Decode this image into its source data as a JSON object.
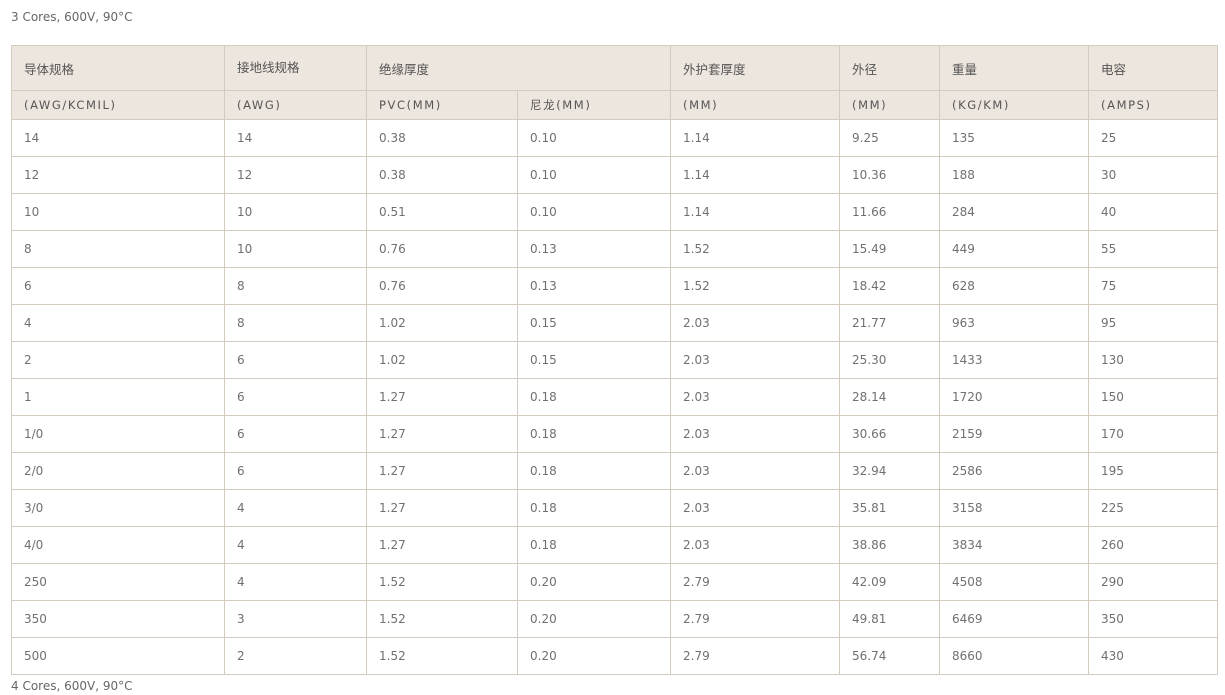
{
  "captions": {
    "top": "3 Cores, 600V, 90°C",
    "bottom": "4 Cores, 600V, 90°C"
  },
  "table": {
    "header_row1": {
      "conductor": "导体规格",
      "ground": "接地线规格",
      "insulation": "绝缘厚度",
      "jacket": "外护套厚度",
      "od": "外径",
      "weight": "重量",
      "capacity": "电容"
    },
    "header_row2": {
      "conductor": "(AWG/KCMIL)",
      "ground": "(AWG)",
      "pvc": "PVC(MM)",
      "nylon": "尼龙(MM)",
      "jacket": "(MM)",
      "od": "(MM)",
      "weight": "(KG/KM)",
      "capacity": "(AMPS)"
    },
    "rows": [
      [
        "14",
        "14",
        "0.38",
        "0.10",
        "1.14",
        "9.25",
        "135",
        "25"
      ],
      [
        "12",
        "12",
        "0.38",
        "0.10",
        "1.14",
        "10.36",
        "188",
        "30"
      ],
      [
        "10",
        "10",
        "0.51",
        "0.10",
        "1.14",
        "11.66",
        "284",
        "40"
      ],
      [
        "8",
        "10",
        "0.76",
        "0.13",
        "1.52",
        "15.49",
        "449",
        "55"
      ],
      [
        "6",
        "8",
        "0.76",
        "0.13",
        "1.52",
        "18.42",
        "628",
        "75"
      ],
      [
        "4",
        "8",
        "1.02",
        "0.15",
        "2.03",
        "21.77",
        "963",
        "95"
      ],
      [
        "2",
        "6",
        "1.02",
        "0.15",
        "2.03",
        "25.30",
        "1433",
        "130"
      ],
      [
        "1",
        "6",
        "1.27",
        "0.18",
        "2.03",
        "28.14",
        "1720",
        "150"
      ],
      [
        "1/0",
        "6",
        "1.27",
        "0.18",
        "2.03",
        "30.66",
        "2159",
        "170"
      ],
      [
        "2/0",
        "6",
        "1.27",
        "0.18",
        "2.03",
        "32.94",
        "2586",
        "195"
      ],
      [
        "3/0",
        "4",
        "1.27",
        "0.18",
        "2.03",
        "35.81",
        "3158",
        "225"
      ],
      [
        "4/0",
        "4",
        "1.27",
        "0.18",
        "2.03",
        "38.86",
        "3834",
        "260"
      ],
      [
        "250",
        "4",
        "1.52",
        "0.20",
        "2.79",
        "42.09",
        "4508",
        "290"
      ],
      [
        "350",
        "3",
        "1.52",
        "0.20",
        "2.79",
        "49.81",
        "6469",
        "350"
      ],
      [
        "500",
        "2",
        "1.52",
        "0.20",
        "2.79",
        "56.74",
        "8660",
        "430"
      ]
    ]
  }
}
